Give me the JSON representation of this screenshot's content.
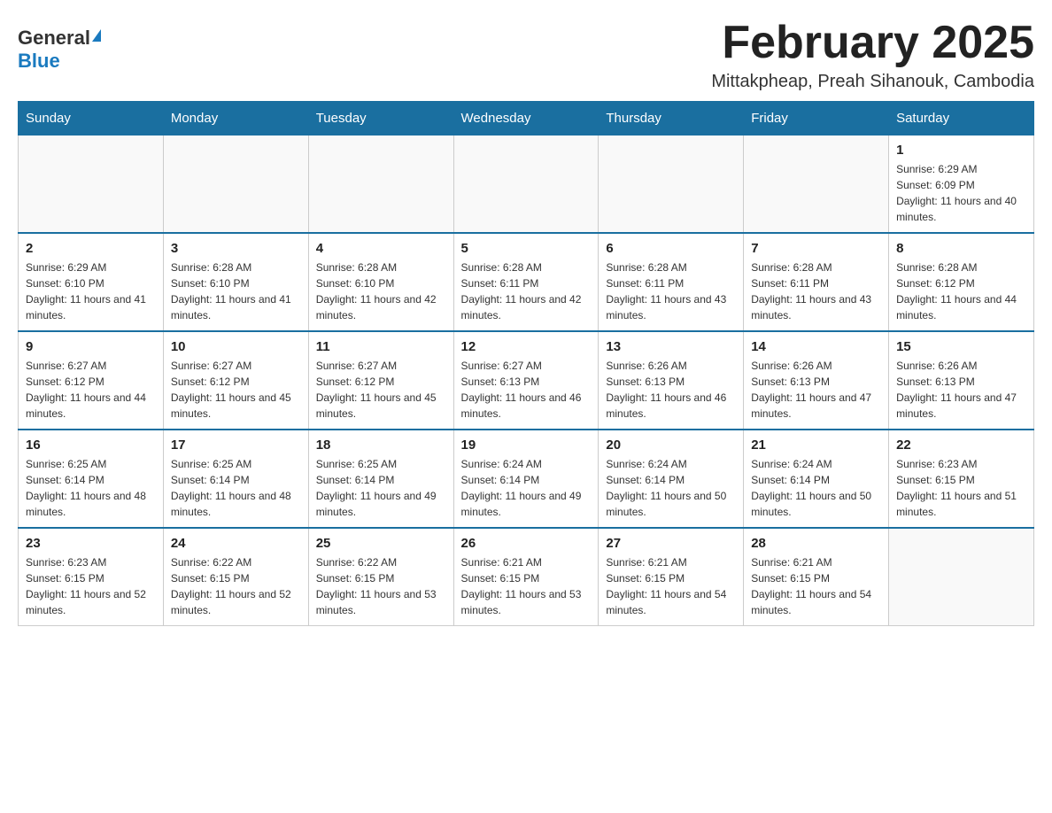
{
  "header": {
    "logo_general": "General",
    "logo_blue": "Blue",
    "month_title": "February 2025",
    "location": "Mittakpheap, Preah Sihanouk, Cambodia"
  },
  "weekdays": [
    "Sunday",
    "Monday",
    "Tuesday",
    "Wednesday",
    "Thursday",
    "Friday",
    "Saturday"
  ],
  "weeks": [
    [
      {
        "day": "",
        "info": ""
      },
      {
        "day": "",
        "info": ""
      },
      {
        "day": "",
        "info": ""
      },
      {
        "day": "",
        "info": ""
      },
      {
        "day": "",
        "info": ""
      },
      {
        "day": "",
        "info": ""
      },
      {
        "day": "1",
        "info": "Sunrise: 6:29 AM\nSunset: 6:09 PM\nDaylight: 11 hours and 40 minutes."
      }
    ],
    [
      {
        "day": "2",
        "info": "Sunrise: 6:29 AM\nSunset: 6:10 PM\nDaylight: 11 hours and 41 minutes."
      },
      {
        "day": "3",
        "info": "Sunrise: 6:28 AM\nSunset: 6:10 PM\nDaylight: 11 hours and 41 minutes."
      },
      {
        "day": "4",
        "info": "Sunrise: 6:28 AM\nSunset: 6:10 PM\nDaylight: 11 hours and 42 minutes."
      },
      {
        "day": "5",
        "info": "Sunrise: 6:28 AM\nSunset: 6:11 PM\nDaylight: 11 hours and 42 minutes."
      },
      {
        "day": "6",
        "info": "Sunrise: 6:28 AM\nSunset: 6:11 PM\nDaylight: 11 hours and 43 minutes."
      },
      {
        "day": "7",
        "info": "Sunrise: 6:28 AM\nSunset: 6:11 PM\nDaylight: 11 hours and 43 minutes."
      },
      {
        "day": "8",
        "info": "Sunrise: 6:28 AM\nSunset: 6:12 PM\nDaylight: 11 hours and 44 minutes."
      }
    ],
    [
      {
        "day": "9",
        "info": "Sunrise: 6:27 AM\nSunset: 6:12 PM\nDaylight: 11 hours and 44 minutes."
      },
      {
        "day": "10",
        "info": "Sunrise: 6:27 AM\nSunset: 6:12 PM\nDaylight: 11 hours and 45 minutes."
      },
      {
        "day": "11",
        "info": "Sunrise: 6:27 AM\nSunset: 6:12 PM\nDaylight: 11 hours and 45 minutes."
      },
      {
        "day": "12",
        "info": "Sunrise: 6:27 AM\nSunset: 6:13 PM\nDaylight: 11 hours and 46 minutes."
      },
      {
        "day": "13",
        "info": "Sunrise: 6:26 AM\nSunset: 6:13 PM\nDaylight: 11 hours and 46 minutes."
      },
      {
        "day": "14",
        "info": "Sunrise: 6:26 AM\nSunset: 6:13 PM\nDaylight: 11 hours and 47 minutes."
      },
      {
        "day": "15",
        "info": "Sunrise: 6:26 AM\nSunset: 6:13 PM\nDaylight: 11 hours and 47 minutes."
      }
    ],
    [
      {
        "day": "16",
        "info": "Sunrise: 6:25 AM\nSunset: 6:14 PM\nDaylight: 11 hours and 48 minutes."
      },
      {
        "day": "17",
        "info": "Sunrise: 6:25 AM\nSunset: 6:14 PM\nDaylight: 11 hours and 48 minutes."
      },
      {
        "day": "18",
        "info": "Sunrise: 6:25 AM\nSunset: 6:14 PM\nDaylight: 11 hours and 49 minutes."
      },
      {
        "day": "19",
        "info": "Sunrise: 6:24 AM\nSunset: 6:14 PM\nDaylight: 11 hours and 49 minutes."
      },
      {
        "day": "20",
        "info": "Sunrise: 6:24 AM\nSunset: 6:14 PM\nDaylight: 11 hours and 50 minutes."
      },
      {
        "day": "21",
        "info": "Sunrise: 6:24 AM\nSunset: 6:14 PM\nDaylight: 11 hours and 50 minutes."
      },
      {
        "day": "22",
        "info": "Sunrise: 6:23 AM\nSunset: 6:15 PM\nDaylight: 11 hours and 51 minutes."
      }
    ],
    [
      {
        "day": "23",
        "info": "Sunrise: 6:23 AM\nSunset: 6:15 PM\nDaylight: 11 hours and 52 minutes."
      },
      {
        "day": "24",
        "info": "Sunrise: 6:22 AM\nSunset: 6:15 PM\nDaylight: 11 hours and 52 minutes."
      },
      {
        "day": "25",
        "info": "Sunrise: 6:22 AM\nSunset: 6:15 PM\nDaylight: 11 hours and 53 minutes."
      },
      {
        "day": "26",
        "info": "Sunrise: 6:21 AM\nSunset: 6:15 PM\nDaylight: 11 hours and 53 minutes."
      },
      {
        "day": "27",
        "info": "Sunrise: 6:21 AM\nSunset: 6:15 PM\nDaylight: 11 hours and 54 minutes."
      },
      {
        "day": "28",
        "info": "Sunrise: 6:21 AM\nSunset: 6:15 PM\nDaylight: 11 hours and 54 minutes."
      },
      {
        "day": "",
        "info": ""
      }
    ]
  ]
}
